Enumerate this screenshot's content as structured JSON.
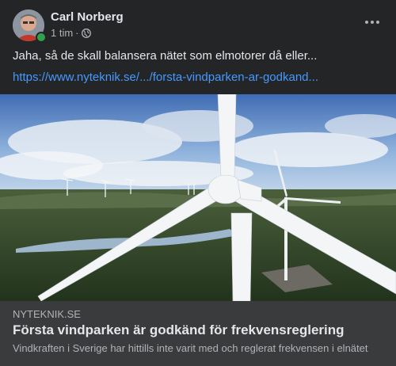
{
  "post": {
    "author": "Carl Norberg",
    "time": "1 tim",
    "separator": "·",
    "privacy_icon": "globe-icon",
    "text": "Jaha, så de skall balansera nätet som elmotorer då eller...",
    "link_text": "https://www.nyteknik.se/.../forsta-vindparken-ar-godkand...",
    "image_icon": "wind-turbine-photo"
  },
  "preview": {
    "domain": "NYTEKNIK.SE",
    "title": "Första vindparken är godkänd för frekvensreglering",
    "description": "Vindkraften i Sverige har hittills inte varit med och reglerat frekvensen i elnätet"
  },
  "colors": {
    "background": "#242526",
    "preview_background": "#3a3b3c",
    "link": "#4599ff",
    "online": "#31a24c"
  }
}
